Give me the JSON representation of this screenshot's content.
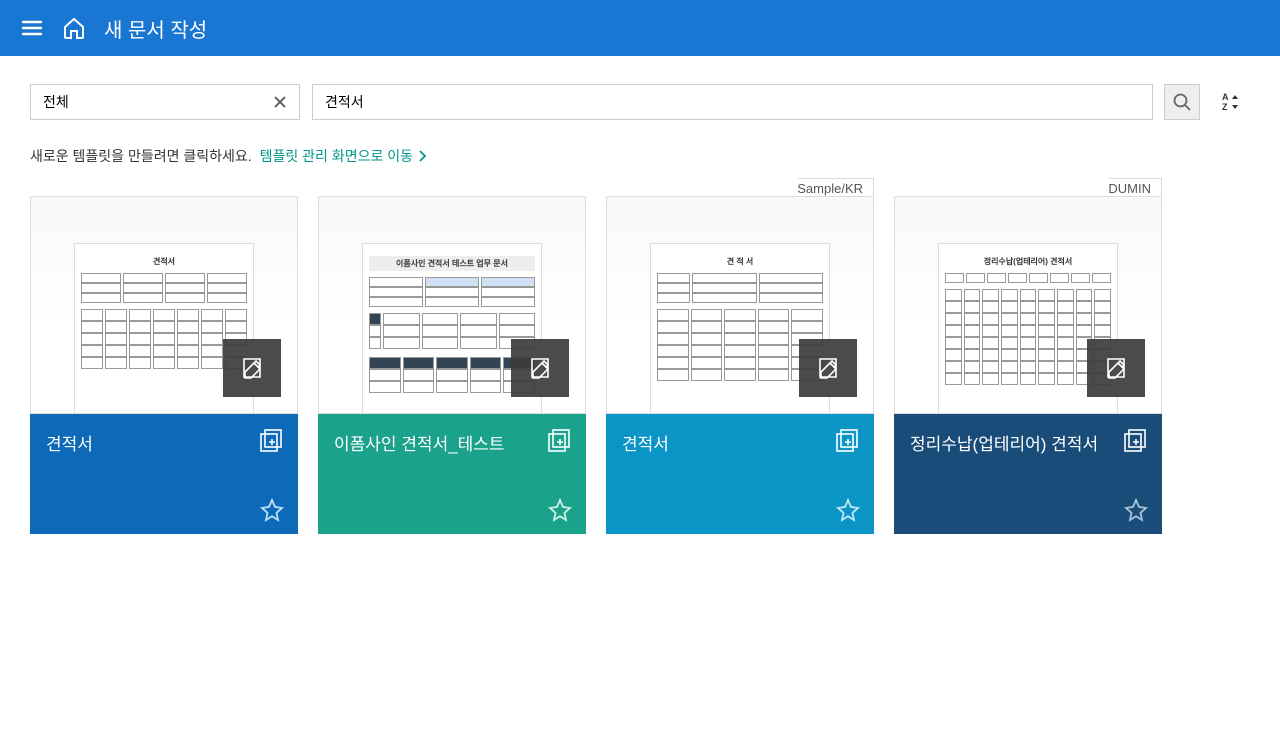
{
  "header": {
    "title": "새 문서 작성"
  },
  "toolbar": {
    "filter_value": "전체",
    "search_value": "견적서"
  },
  "hint": {
    "text": "새로운 템플릿을 만들려면 클릭하세요.",
    "link": "템플릿 관리 화면으로 이동"
  },
  "cards": [
    {
      "title": "견적서",
      "tag": "",
      "thumb_title": "견적서"
    },
    {
      "title": "이폼사인 견적서_테스트",
      "tag": "",
      "thumb_title": "이폼사인 견적서 테스트 업무 문서"
    },
    {
      "title": "견적서",
      "tag": "Sample/KR",
      "thumb_title": "견 적 서"
    },
    {
      "title": "정리수납(업테리어) 견적서",
      "tag": "DUMIN",
      "thumb_title": "정리수납(업테리어) 견적서"
    }
  ]
}
